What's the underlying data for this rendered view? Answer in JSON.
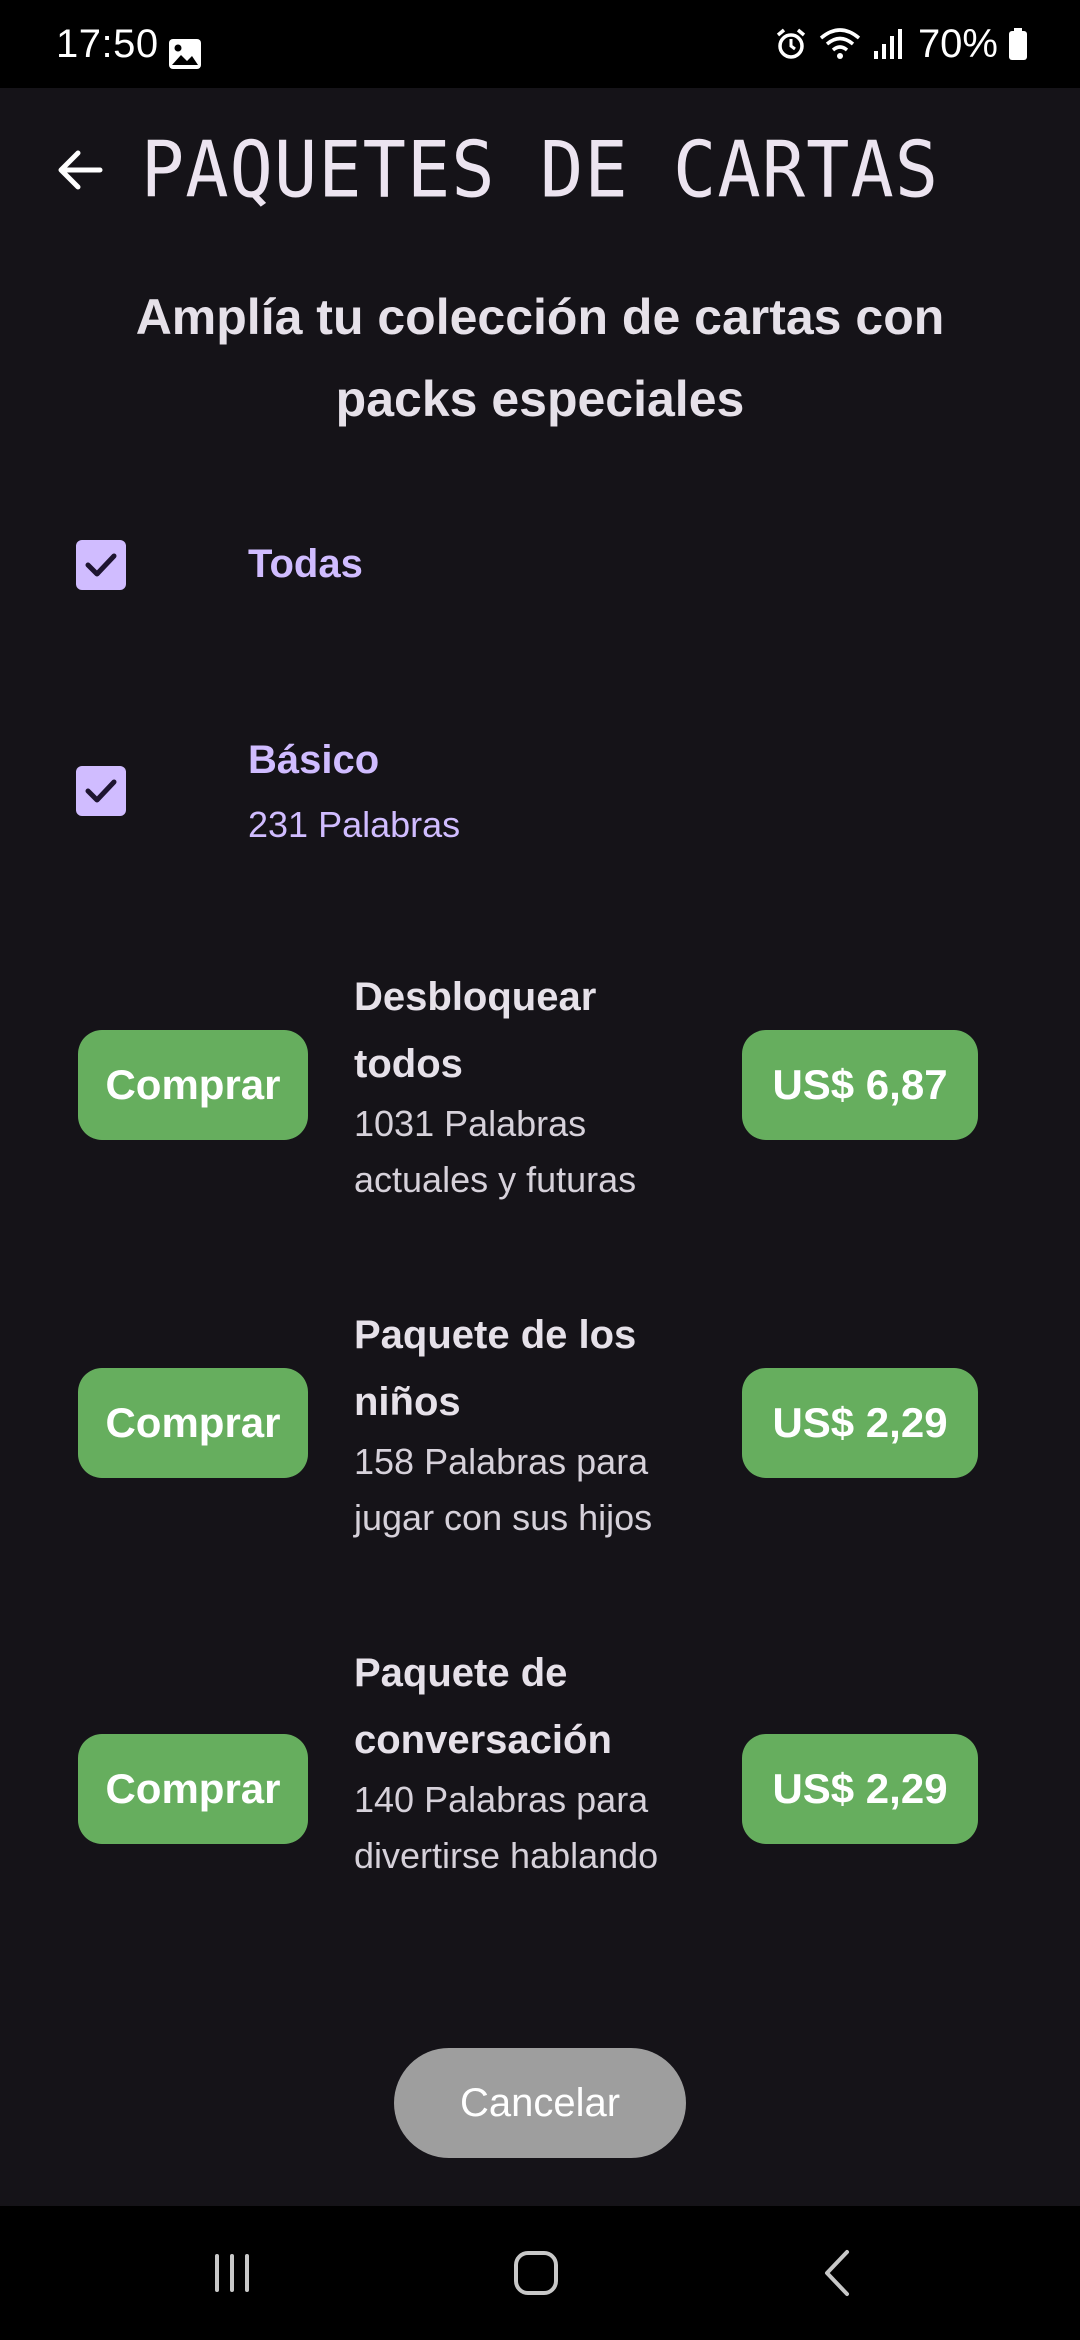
{
  "status_bar": {
    "time": "17:50",
    "battery": "70%",
    "icons": [
      "image-icon",
      "alarm-icon",
      "wifi-icon",
      "signal-icon",
      "battery-icon"
    ]
  },
  "app_bar": {
    "title": "PAQUETES DE CARTAS",
    "back_icon": "arrow-left-icon"
  },
  "subtitle": "Amplía tu colección de cartas con packs especiales",
  "filters": [
    {
      "label": "Todas",
      "checked": true
    },
    {
      "label": "Básico",
      "sub": "231 Palabras",
      "checked": true
    }
  ],
  "packs": [
    {
      "buy_label": "Comprar",
      "title": "Desbloquear todos",
      "desc": "1031 Palabras actuales y futuras",
      "price": "US$ 6,87"
    },
    {
      "buy_label": "Comprar",
      "title": "Paquete de los niños",
      "desc": "158 Palabras para jugar con sus hijos",
      "price": "US$ 2,29"
    },
    {
      "buy_label": "Comprar",
      "title": "Paquete de conversación",
      "desc": "140 Palabras para divertirse hablando",
      "price": "US$ 2,29"
    }
  ],
  "cancel_label": "Cancelar",
  "colors": {
    "background": "#151318",
    "accent": "#d0bcff",
    "buy_green": "#66ae5e",
    "cancel_gray": "#9e9e9e"
  },
  "nav_icons": [
    "recents-icon",
    "home-icon",
    "back-nav-icon"
  ]
}
